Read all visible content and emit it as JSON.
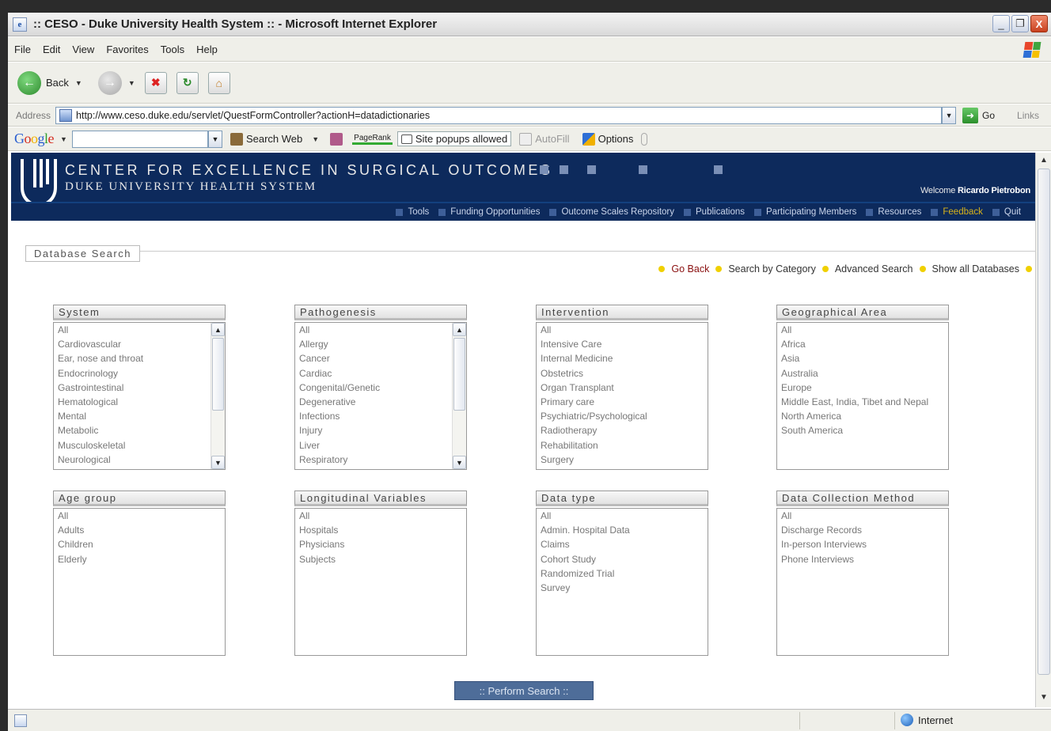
{
  "window": {
    "icon": "e",
    "title": ":: CESO - Duke University Health System :: - Microsoft Internet Explorer",
    "controls": {
      "minimize": "_",
      "restore": "❐",
      "close": "X"
    }
  },
  "menu": [
    "File",
    "Edit",
    "View",
    "Favorites",
    "Tools",
    "Help"
  ],
  "toolbar": {
    "back_label": "Back"
  },
  "address": {
    "label": "Address",
    "url": "http://www.ceso.duke.edu/servlet/QuestFormController?actionH=datadictionaries",
    "go_label": "Go",
    "links_label": "Links"
  },
  "google_toolbar": {
    "logo_letters": [
      "G",
      "o",
      "o",
      "g",
      "l",
      "e"
    ],
    "search_web": "Search Web",
    "pagerank": "PageRank",
    "popups": "Site popups allowed",
    "autofill": "AutoFill",
    "options": "Options"
  },
  "site": {
    "title": "CENTER FOR EXCELLENCE IN SURGICAL OUTCOMES",
    "subtitle": "DUKE UNIVERSITY HEALTH SYSTEM",
    "welcome_prefix": "Welcome",
    "user_name": "Ricardo Pietrobon",
    "nav": [
      "Tools",
      "Funding Opportunities",
      "Outcome Scales Repository",
      "Publications",
      "Participating Members",
      "Resources",
      "Feedback",
      "Quit"
    ]
  },
  "search": {
    "section_label": "Database Search",
    "links": [
      "Go Back",
      "Search by Category",
      "Advanced Search",
      "Show all Databases"
    ],
    "perform_button": ":: Perform Search ::"
  },
  "filters": [
    {
      "title": "System",
      "options": [
        "All",
        "Cardiovascular",
        "Ear, nose and throat",
        "Endocrinology",
        "Gastrointestinal",
        "Hematological",
        "Mental",
        "Metabolic",
        "Musculoskeletal",
        "Neurological"
      ]
    },
    {
      "title": "Pathogenesis",
      "options": [
        "All",
        "Allergy",
        "Cancer",
        "Cardiac",
        "Congenital/Genetic",
        "Degenerative",
        "Infections",
        "Injury",
        "Liver",
        "Respiratory"
      ]
    },
    {
      "title": "Intervention",
      "options": [
        "All",
        "Intensive Care",
        "Internal Medicine",
        "Obstetrics",
        "Organ Transplant",
        "Primary care",
        "Psychiatric/Psychological",
        "Radiotherapy",
        "Rehabilitation",
        "Surgery"
      ]
    },
    {
      "title": "Geographical Area",
      "options": [
        "All",
        "Africa",
        "Asia",
        "Australia",
        "Europe",
        "Middle East, India, Tibet and Nepal",
        "North America",
        "South America"
      ]
    },
    {
      "title": "Age group",
      "options": [
        "All",
        "Adults",
        "Children",
        "Elderly"
      ]
    },
    {
      "title": "Longitudinal Variables",
      "options": [
        "All",
        "Hospitals",
        "Physicians",
        "Subjects"
      ]
    },
    {
      "title": "Data type",
      "options": [
        "All",
        "Admin. Hospital Data",
        "Claims",
        "Cohort Study",
        "Randomized Trial",
        "Survey"
      ]
    },
    {
      "title": "Data Collection Method",
      "options": [
        "All",
        "Discharge Records",
        "In-person Interviews",
        "Phone Interviews"
      ]
    }
  ],
  "status": {
    "zone": "Internet"
  },
  "colors": {
    "header_bg": "#0d2a5c",
    "feedback": "#d8b31a",
    "bullet": "#f0d000",
    "button_bg": "#4e6d99"
  }
}
